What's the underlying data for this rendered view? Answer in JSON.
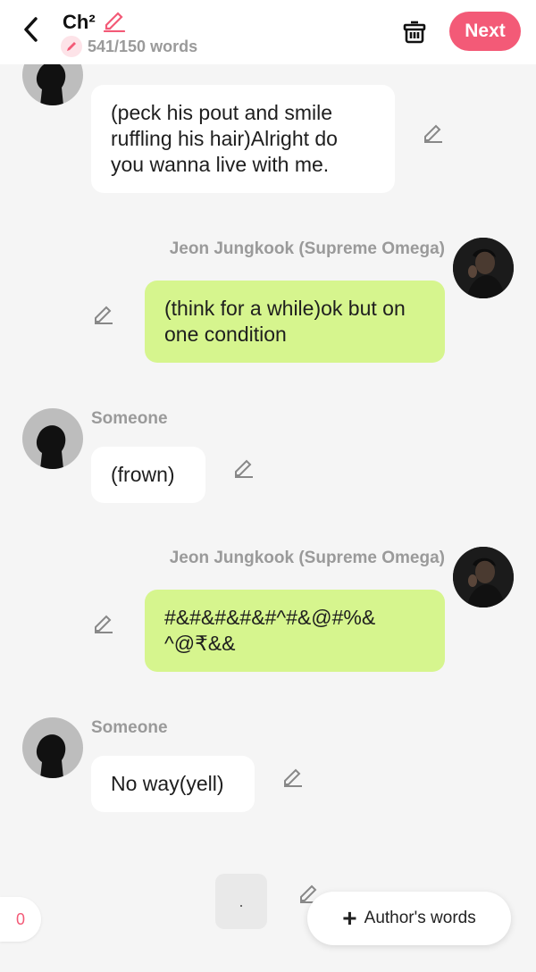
{
  "header": {
    "title": "Ch²",
    "word_count": "541/150 words",
    "next_label": "Next"
  },
  "messages": [
    {
      "speaker": "",
      "text": "(peck his pout and smile ruffling his hair)Alright do you wanna live with me."
    },
    {
      "speaker": "Jeon Jungkook (Supreme Omega)",
      "text": "(think for a while)ok but on one condition"
    },
    {
      "speaker": "Someone",
      "text": "(frown)"
    },
    {
      "speaker": "Jeon Jungkook (Supreme Omega)",
      "text": "#&#&#&#&#^#&@#%& ^@₹&&"
    },
    {
      "speaker": "Someone",
      "text": "No way(yell)"
    }
  ],
  "footer": {
    "count": "0",
    "placeholder_dot": ".",
    "authors_words_label": "Author's words"
  },
  "colors": {
    "accent": "#f35a77",
    "green_bubble": "#d6f58e",
    "white_bubble": "#ffffff",
    "background": "#f5f5f5"
  },
  "icons": [
    "back-arrow-icon",
    "pencil-icon",
    "trash-icon",
    "edit-pencil-icon",
    "plus-icon",
    "silhouette-avatar",
    "photo-avatar"
  ]
}
